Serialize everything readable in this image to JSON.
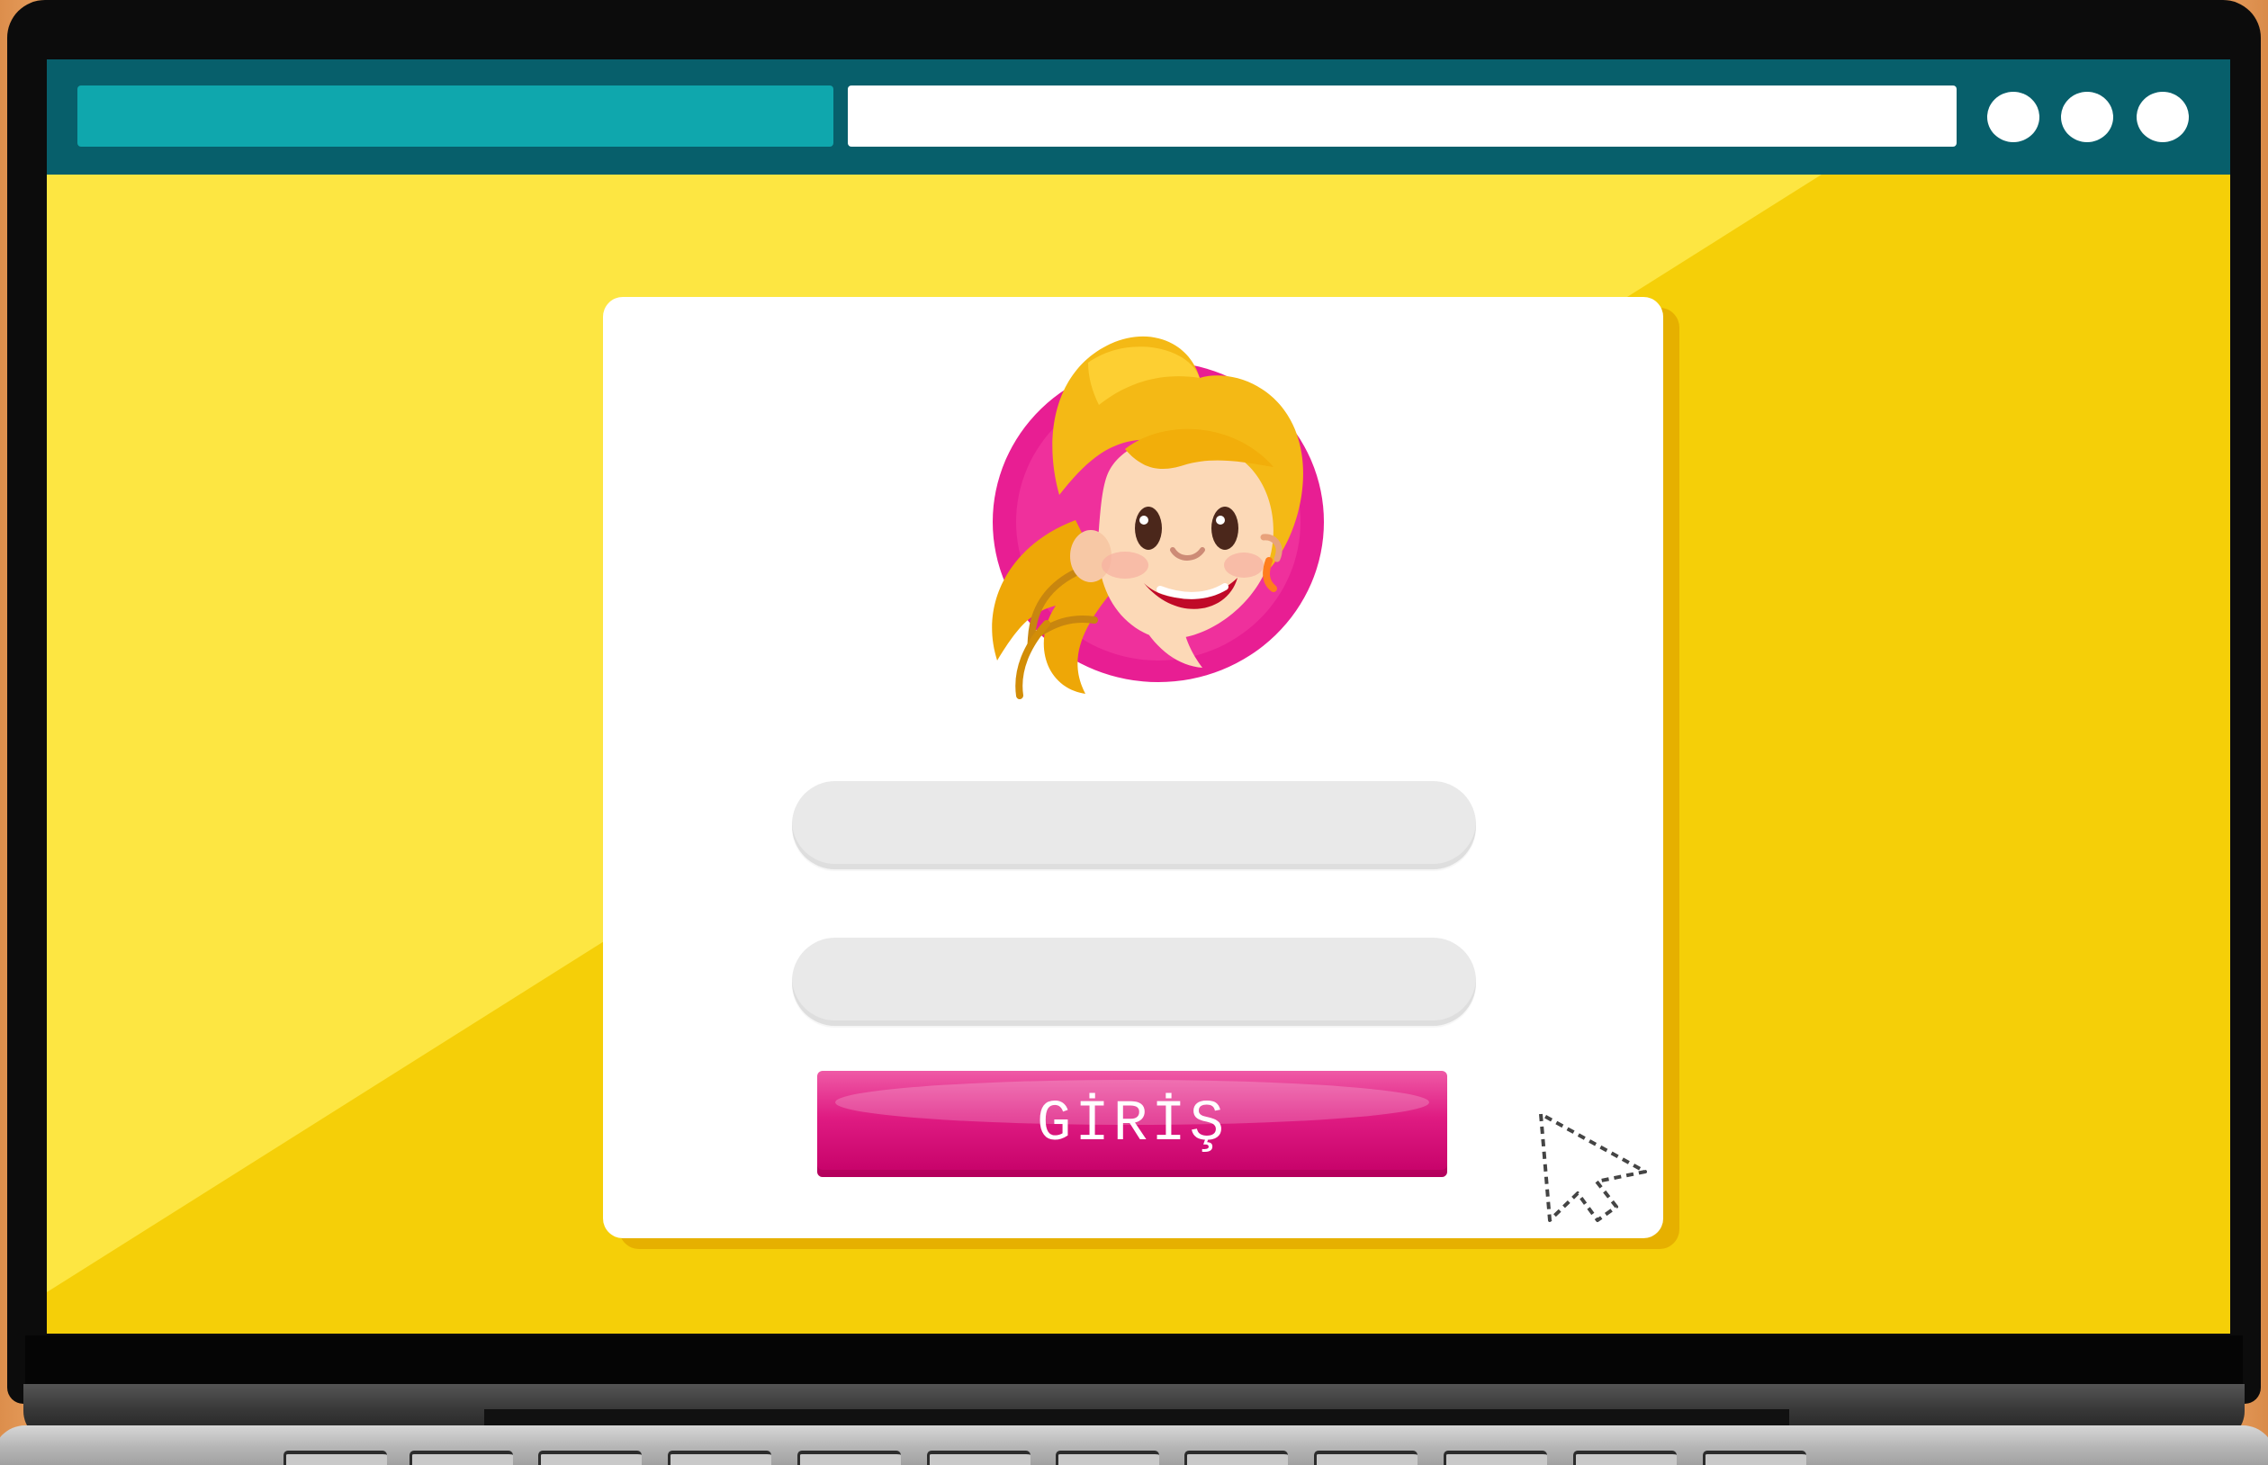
{
  "browser": {
    "window_controls": [
      {
        "name": "window-control-1-icon"
      },
      {
        "name": "window-control-2-icon"
      },
      {
        "name": "window-control-3-icon"
      }
    ]
  },
  "login": {
    "button_label": "GİRİŞ",
    "username_value": "",
    "password_value": ""
  },
  "icons": {
    "avatar": "girl-avatar-icon",
    "pointer": "mouse-pointer-icon"
  },
  "colors": {
    "screen_yellow": "#f5cf08",
    "browser_bar": "#075f6b",
    "tab_teal": "#0fa7ad",
    "login_pink": "#df1b82",
    "avatar_magenta": "#e81e93"
  }
}
